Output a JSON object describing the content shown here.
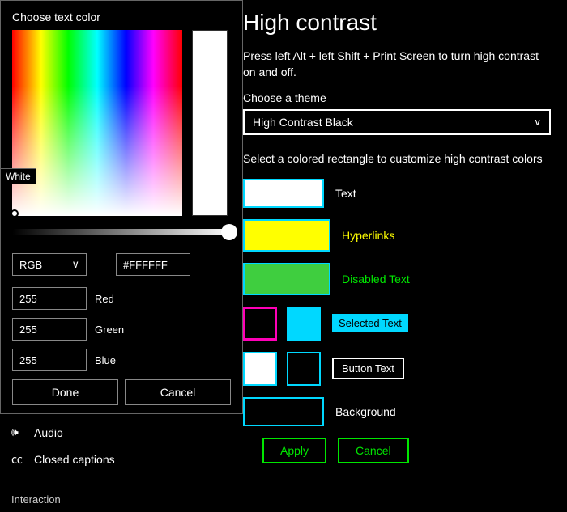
{
  "page": {
    "title": "High contrast",
    "hint": "Press left Alt + left Shift + Print Screen to turn high contrast on and off.",
    "choose_label": "Choose a theme",
    "theme_value": "High Contrast Black",
    "select_hint": "Select a colored rectangle to customize high contrast colors",
    "rows": {
      "text": "Text",
      "hyperlinks": "Hyperlinks",
      "disabled": "Disabled Text",
      "selected": "Selected Text",
      "button": "Button Text",
      "background": "Background"
    },
    "apply": "Apply",
    "cancel": "Cancel"
  },
  "sidebar": {
    "audio": "Audio",
    "closed_captions": "Closed captions",
    "interaction": "Interaction"
  },
  "picker": {
    "title": "Choose text color",
    "mode": "RGB",
    "hex": "#FFFFFF",
    "r": "255",
    "g": "255",
    "b": "255",
    "r_label": "Red",
    "g_label": "Green",
    "b_label": "Blue",
    "done": "Done",
    "cancel": "Cancel",
    "tooltip": "White"
  }
}
